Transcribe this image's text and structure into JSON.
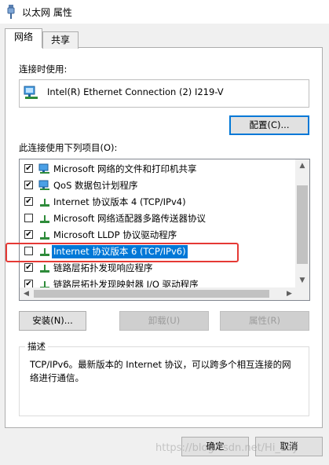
{
  "window": {
    "title": "以太网 属性"
  },
  "tabs": [
    {
      "label": "网络",
      "active": true
    },
    {
      "label": "共享",
      "active": false
    }
  ],
  "connection": {
    "label": "连接时使用:",
    "adapter": "Intel(R) Ethernet Connection (2) I219-V",
    "configure_button": "配置(C)..."
  },
  "items": {
    "label": "此连接使用下列项目(O):",
    "list": [
      {
        "label": "Microsoft 网络的文件和打印机共享",
        "checked": true,
        "icon": "network-client-icon"
      },
      {
        "label": "QoS 数据包计划程序",
        "checked": true,
        "icon": "network-client-icon"
      },
      {
        "label": "Internet 协议版本 4 (TCP/IPv4)",
        "checked": true,
        "icon": "protocol-icon"
      },
      {
        "label": "Microsoft 网络适配器多路传送器协议",
        "checked": false,
        "icon": "protocol-icon"
      },
      {
        "label": "Microsoft LLDP 协议驱动程序",
        "checked": true,
        "icon": "protocol-icon"
      },
      {
        "label": "Internet 协议版本 6 (TCP/IPv6)",
        "checked": false,
        "icon": "protocol-icon",
        "selected": true
      },
      {
        "label": "链路层拓扑发现响应程序",
        "checked": true,
        "icon": "protocol-icon"
      },
      {
        "label": "链路层拓扑发现映射器 I/O 驱动程序",
        "checked": true,
        "icon": "protocol-icon"
      }
    ]
  },
  "buttons": {
    "install": "安装(N)...",
    "uninstall": "卸载(U)",
    "properties": "属性(R)",
    "ok": "确定",
    "cancel": "取消"
  },
  "description": {
    "title": "描述",
    "text": "TCP/IPv6。最新版本的 Internet 协议，可以跨多个相互连接的网络进行通信。"
  },
  "watermark": "https://blog.csdn.net/Hi_Lay",
  "colors": {
    "selection": "#0078d7",
    "highlight_box": "#e53935",
    "focus_border": "#0078d7"
  }
}
